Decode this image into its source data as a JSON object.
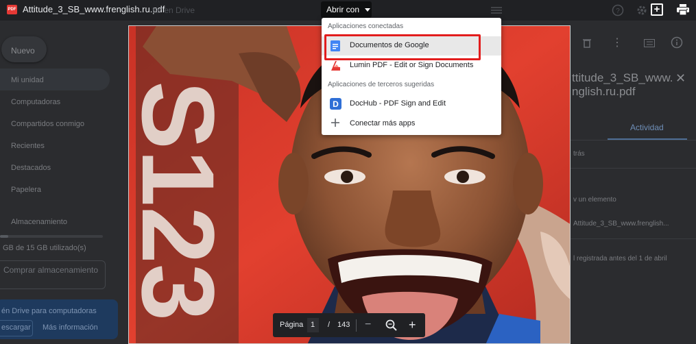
{
  "topbar": {
    "file_badge": "PDF",
    "filename": "Attitude_3_SB_www.frenglish.ru.pdf",
    "open_with": "Abrir con",
    "faded_title": "tar en Drive"
  },
  "menu": {
    "connected_header": "Aplicaciones conectadas",
    "suggested_header": "Aplicaciones de terceros sugeridas",
    "items": [
      {
        "label": "Documentos de Google",
        "icon": "google-docs-icon"
      },
      {
        "label": "Lumin PDF - Edit or Sign Documents",
        "icon": "lumin-pdf-icon"
      },
      {
        "label": "DocHub - PDF Sign and Edit",
        "icon": "dochub-icon"
      },
      {
        "label": "Conectar más apps",
        "icon": "plus-icon"
      }
    ]
  },
  "sidebar": {
    "new_button": "Nuevo",
    "items": [
      "Mi unidad",
      "Computadoras",
      "Compartidos conmigo",
      "Recientes",
      "Destacados",
      "Papelera"
    ],
    "storage_label": "Almacenamiento",
    "storage_used": "GB de 15 GB utilizado(s)",
    "buy_button": "Comprar almacenamiento",
    "promo_text": "én Drive para computadoras",
    "promo_download": "escargar",
    "promo_more": "Más información"
  },
  "right_panel": {
    "title_line1": "ttitude_3_SB_www.",
    "title_line2": "nglish.ru.pdf",
    "tab_activity": "Actividad",
    "text1": "trás",
    "text2": "v un elemento",
    "text3": "Attitude_3_SB_www.frenglish...",
    "text4": "l registrada antes del 1 de abril"
  },
  "pager": {
    "label": "Página",
    "current": "1",
    "separator": "/",
    "total": "143",
    "minus": "−",
    "plus": "+"
  },
  "cover": {
    "letters": "S123"
  },
  "colors": {
    "highlight": "#e21d1d",
    "docs_blue": "#4285f4",
    "dochub_blue": "#2f6fd6",
    "lumin_red": "#e53935"
  }
}
